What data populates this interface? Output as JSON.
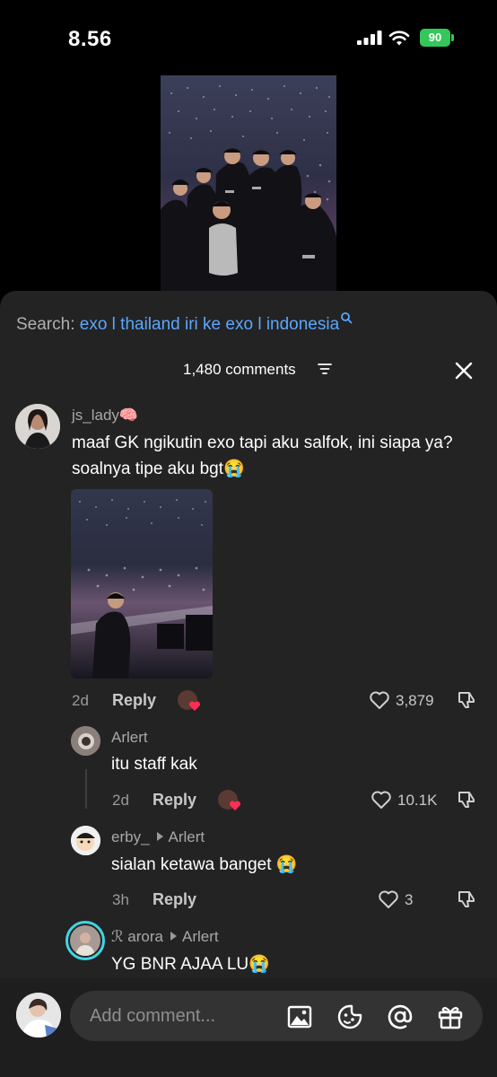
{
  "status_bar": {
    "time": "8.56",
    "battery": "90",
    "battery_color": "#34c759"
  },
  "search": {
    "label": "Search: ",
    "query": "exo l thailand iri ke exo l indonesia"
  },
  "header": {
    "comments_count": "1,480 comments"
  },
  "comments": [
    {
      "username": "js_lady🧠",
      "text": "maaf GK ngikutin exo tapi aku salfok, ini siapa ya? soalnya tipe aku bgt😭",
      "time": "2d",
      "reply": "Reply",
      "likes": "3,879"
    },
    {
      "username": "Arlert",
      "text": "itu staff kak",
      "time": "2d",
      "reply": "Reply",
      "likes": "10.1K"
    },
    {
      "username": "erby_",
      "reply_to": "Arlert",
      "text": "sialan ketawa banget 😭",
      "time": "3h",
      "reply": "Reply",
      "likes": "3"
    },
    {
      "username": "ℛ arora",
      "reply_to": "Arlert",
      "text": "YG BNR AJAA LU😭"
    }
  ],
  "composer": {
    "placeholder": "Add comment..."
  },
  "colors": {
    "link": "#5aa7ff",
    "sheet_bg": "#232323",
    "heart_red": "#ff2d55",
    "story_ring": "#3fd6e6"
  },
  "icons": [
    "signal-icon",
    "wifi-icon",
    "battery-icon",
    "search-icon",
    "sort-icon",
    "close-icon",
    "heart-icon",
    "dislike-icon",
    "image-icon",
    "emoji-icon",
    "mention-icon",
    "gift-icon"
  ]
}
